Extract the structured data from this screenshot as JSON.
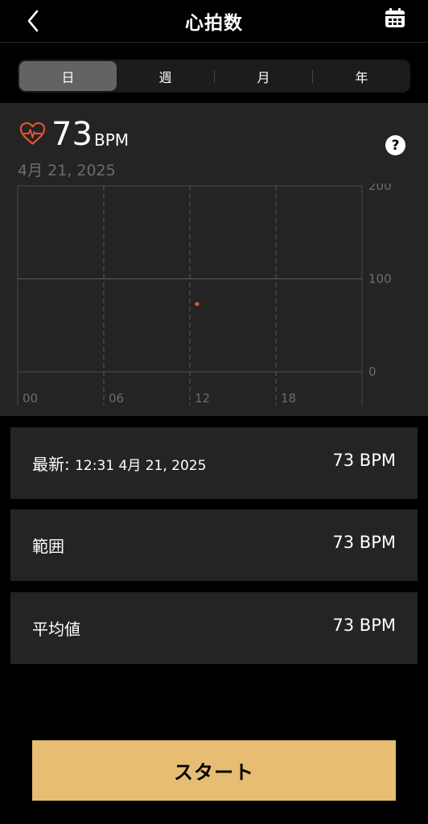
{
  "header": {
    "title": "心拍数"
  },
  "tabs": [
    {
      "label": "日",
      "active": true
    },
    {
      "label": "週",
      "active": false
    },
    {
      "label": "月",
      "active": false
    },
    {
      "label": "年",
      "active": false
    }
  ],
  "summary": {
    "value": "73",
    "unit": "BPM",
    "date": "4月 21, 2025",
    "help": "?"
  },
  "chart_data": {
    "type": "scatter",
    "x_ticks": [
      "00",
      "06",
      "12",
      "18"
    ],
    "y_ticks": [
      "200",
      "100",
      "0"
    ],
    "xlim": [
      0,
      24
    ],
    "ylim": [
      0,
      200
    ],
    "points": [
      {
        "x": 12.5,
        "y": 73
      }
    ],
    "grid": true,
    "point_color": "#e8542c"
  },
  "stats": {
    "latest_label": "最新:",
    "latest_time": "12:31 4月 21, 2025",
    "latest_value": "73 BPM",
    "range_label": "範囲",
    "range_value": "73 BPM",
    "avg_label": "平均値",
    "avg_value": "73 BPM"
  },
  "start_button": {
    "label": "スタート"
  },
  "colors": {
    "accent": "#e6bd72",
    "heart": "#e8542c",
    "card": "#242424"
  }
}
